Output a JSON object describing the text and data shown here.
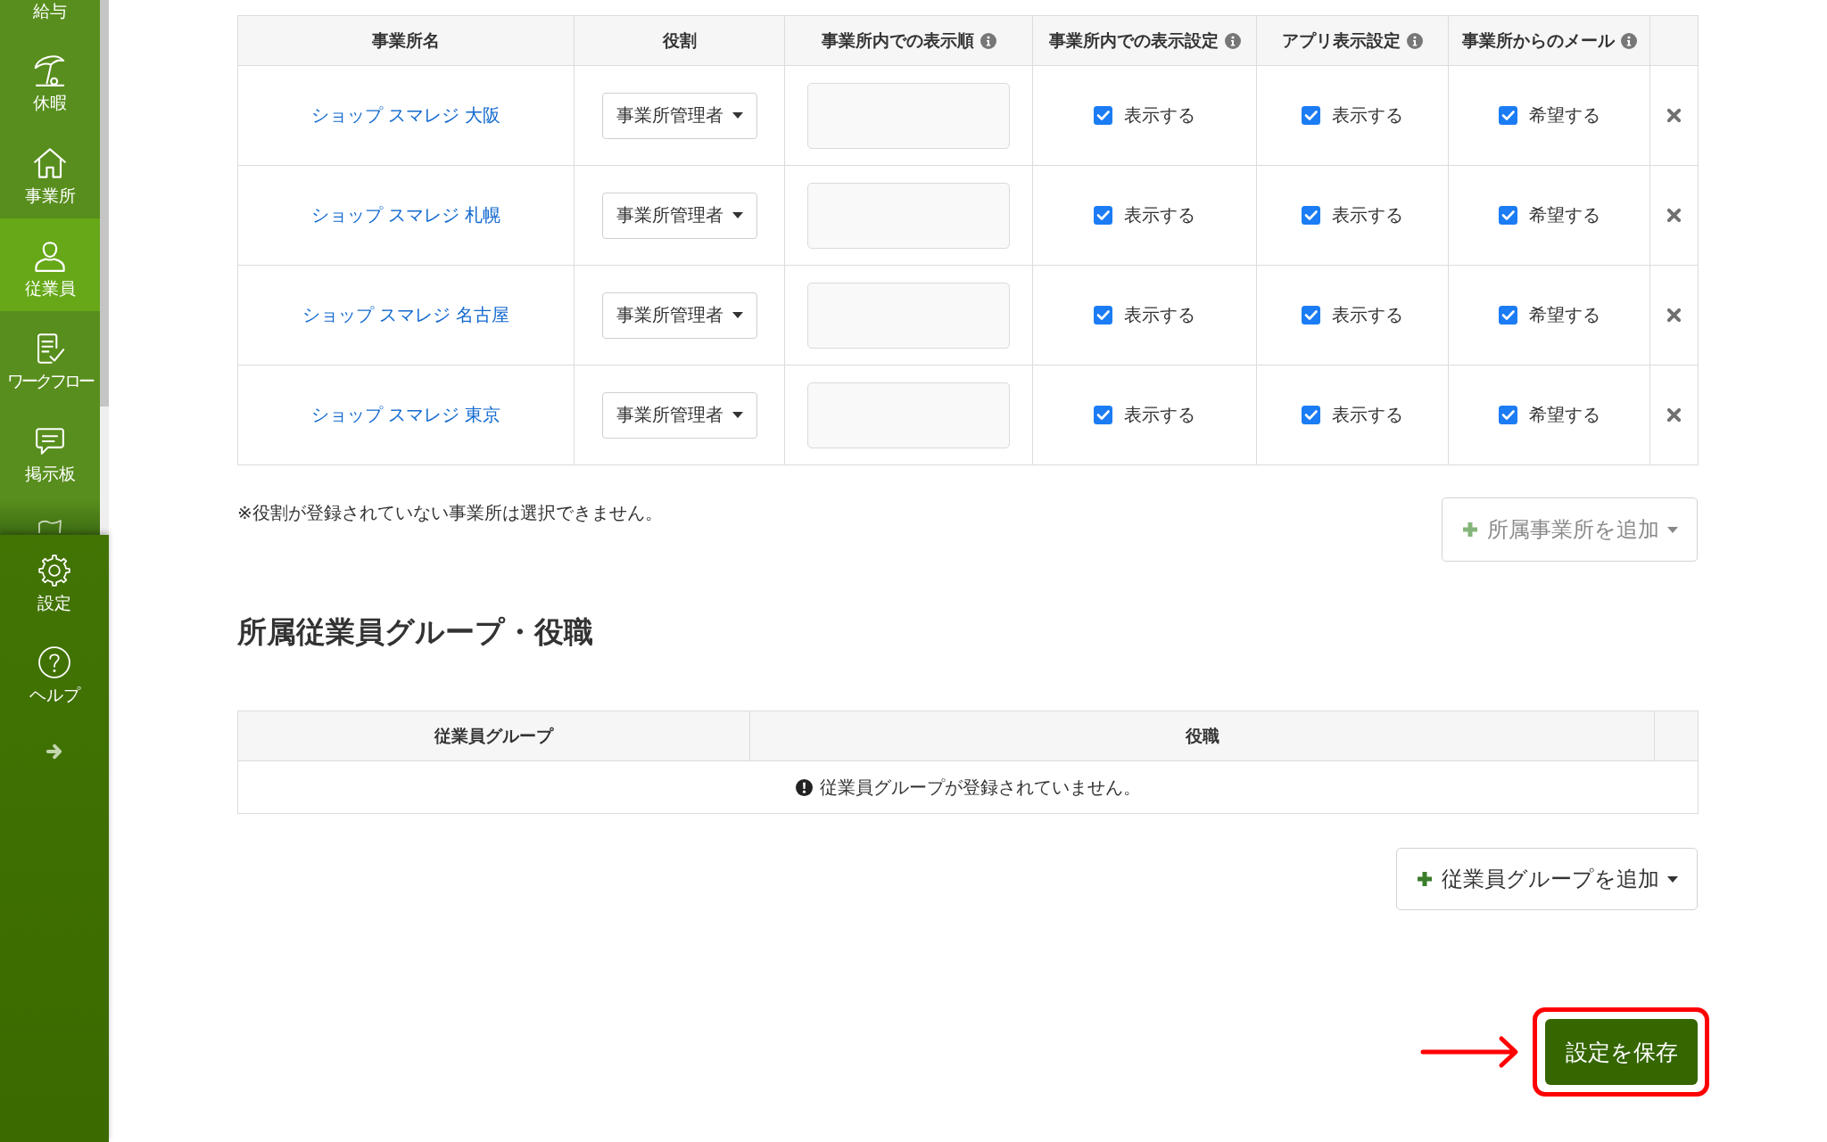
{
  "sidebar": {
    "items": [
      {
        "label": "給与",
        "selected": false
      },
      {
        "label": "休暇",
        "selected": false
      },
      {
        "label": "事業所",
        "selected": false
      },
      {
        "label": "従業員",
        "selected": true
      },
      {
        "label": "ワークフロー",
        "selected": false
      },
      {
        "label": "掲示板",
        "selected": false
      }
    ],
    "footer_items": [
      {
        "label": "設定",
        "selected": false
      },
      {
        "label": "ヘルプ",
        "selected": false
      }
    ]
  },
  "offices_table": {
    "columns": [
      {
        "label": "事業所名",
        "info": false
      },
      {
        "label": "役割",
        "info": false
      },
      {
        "label": "事業所内での表示順",
        "info": true
      },
      {
        "label": "事業所内での表示設定",
        "info": true
      },
      {
        "label": "アプリ表示設定",
        "info": true
      },
      {
        "label": "事業所からのメール",
        "info": true
      }
    ],
    "rows": [
      {
        "office": "ショップ スマレジ 大阪",
        "role": "事業所管理者",
        "checks": [
          {
            "checked": true,
            "label": "表示する"
          },
          {
            "checked": true,
            "label": "表示する"
          },
          {
            "checked": true,
            "label": "希望する"
          }
        ]
      },
      {
        "office": "ショップ スマレジ 札幌",
        "role": "事業所管理者",
        "checks": [
          {
            "checked": true,
            "label": "表示する"
          },
          {
            "checked": true,
            "label": "表示する"
          },
          {
            "checked": true,
            "label": "希望する"
          }
        ]
      },
      {
        "office": "ショップ スマレジ 名古屋",
        "role": "事業所管理者",
        "checks": [
          {
            "checked": true,
            "label": "表示する"
          },
          {
            "checked": true,
            "label": "表示する"
          },
          {
            "checked": true,
            "label": "希望する"
          }
        ]
      },
      {
        "office": "ショップ スマレジ 東京",
        "role": "事業所管理者",
        "checks": [
          {
            "checked": true,
            "label": "表示する"
          },
          {
            "checked": true,
            "label": "表示する"
          },
          {
            "checked": true,
            "label": "希望する"
          }
        ]
      }
    ],
    "note": "※役割が登録されていない事業所は選択できません。",
    "add_button": {
      "label": "所属事業所を追加",
      "disabled": true
    }
  },
  "groups_section": {
    "heading": "所属従業員グループ・役職",
    "columns": [
      "従業員グループ",
      "役職"
    ],
    "empty_message": "従業員グループが登録されていません。",
    "add_button": {
      "label": "従業員グループを追加",
      "disabled": false
    }
  },
  "save_button": {
    "label": "設定を保存"
  }
}
